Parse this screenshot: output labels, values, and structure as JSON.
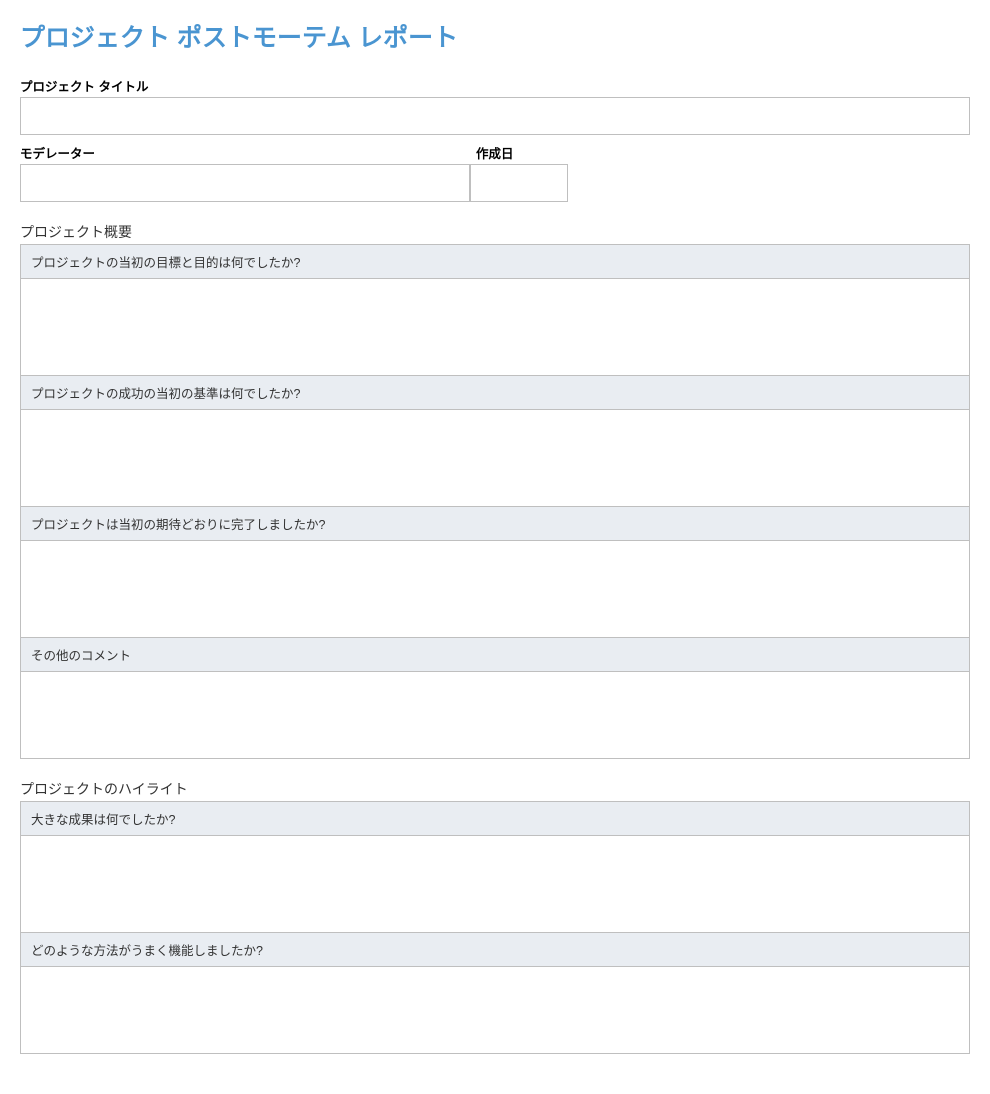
{
  "title": "プロジェクト ポストモーテム レポート",
  "fields": {
    "project_title_label": "プロジェクト タイトル",
    "project_title_value": "",
    "moderator_label": "モデレーター",
    "moderator_value": "",
    "created_date_label": "作成日",
    "created_date_value": ""
  },
  "sections": [
    {
      "heading": "プロジェクト概要",
      "questions": [
        {
          "q": "プロジェクトの当初の目標と目的は何でしたか?",
          "a": ""
        },
        {
          "q": "プロジェクトの成功の当初の基準は何でしたか?",
          "a": ""
        },
        {
          "q": "プロジェクトは当初の期待どおりに完了しましたか?",
          "a": ""
        },
        {
          "q": "その他のコメント",
          "a": ""
        }
      ]
    },
    {
      "heading": "プロジェクトのハイライト",
      "questions": [
        {
          "q": "大きな成果は何でしたか?",
          "a": ""
        },
        {
          "q": "どのような方法がうまく機能しましたか?",
          "a": ""
        }
      ]
    }
  ]
}
